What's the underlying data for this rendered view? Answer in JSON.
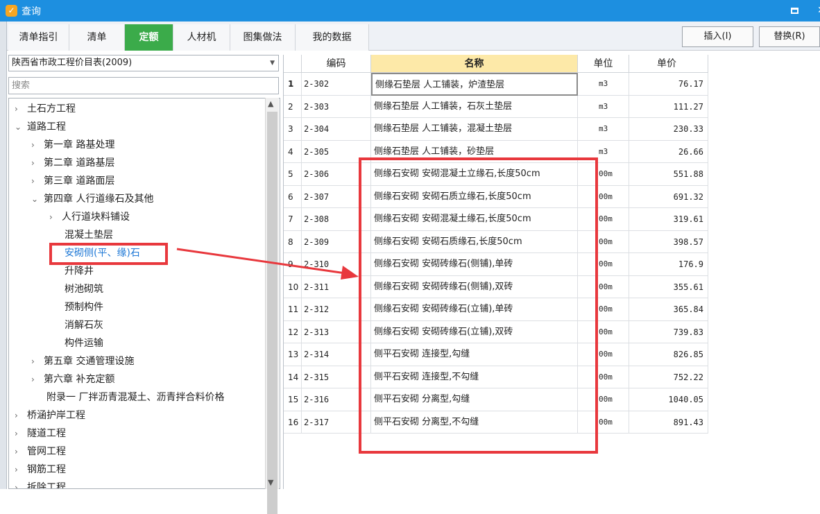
{
  "window": {
    "title": "查询",
    "app_icon_glyph": "✓"
  },
  "tabs": [
    {
      "label": "清单指引"
    },
    {
      "label": "清单"
    },
    {
      "label": "定额"
    },
    {
      "label": "人材机"
    },
    {
      "label": "图集做法"
    },
    {
      "label": "我的数据"
    }
  ],
  "actions": {
    "insert_label": "插入(I)",
    "replace_label": "替换(R)"
  },
  "left": {
    "combo_value": "陕西省市政工程价目表(2009)",
    "search_placeholder": "搜索",
    "tree": [
      {
        "label": "土石方工程",
        "chev": "›"
      },
      {
        "label": "道路工程",
        "chev": "⌄"
      },
      {
        "label": "第一章 路基处理",
        "chev": "›"
      },
      {
        "label": "第二章 道路基层",
        "chev": "›"
      },
      {
        "label": "第三章 道路面层",
        "chev": "›"
      },
      {
        "label": "第四章 人行道缘石及其他",
        "chev": "⌄"
      },
      {
        "label": "人行道块料铺设",
        "chev": "›"
      },
      {
        "label": "混凝土垫层",
        "chev": ""
      },
      {
        "label": "安砌侧(平、缘)石",
        "chev": ""
      },
      {
        "label": "升降井",
        "chev": ""
      },
      {
        "label": "树池砌筑",
        "chev": ""
      },
      {
        "label": "预制构件",
        "chev": ""
      },
      {
        "label": "消解石灰",
        "chev": ""
      },
      {
        "label": "构件运输",
        "chev": ""
      },
      {
        "label": "第五章 交通管理设施",
        "chev": "›"
      },
      {
        "label": "第六章 补充定额",
        "chev": "›"
      },
      {
        "label": "附录一 厂拌沥青混凝土、沥青拌合料价格",
        "chev": ""
      },
      {
        "label": "桥涵护岸工程",
        "chev": "›"
      },
      {
        "label": "隧道工程",
        "chev": "›"
      },
      {
        "label": "管网工程",
        "chev": "›"
      },
      {
        "label": "钢筋工程",
        "chev": "›"
      },
      {
        "label": "拆除工程",
        "chev": "›"
      }
    ]
  },
  "grid": {
    "headers": {
      "code": "编码",
      "name": "名称",
      "unit": "单位",
      "price": "单价"
    },
    "rows": [
      {
        "num": "1",
        "code": "2-302",
        "name": "侧缘石垫层 人工铺装，炉渣垫层",
        "unit": "m3",
        "price": "76.17"
      },
      {
        "num": "2",
        "code": "2-303",
        "name": "侧缘石垫层 人工铺装，石灰土垫层",
        "unit": "m3",
        "price": "111.27"
      },
      {
        "num": "3",
        "code": "2-304",
        "name": "侧缘石垫层 人工铺装，混凝土垫层",
        "unit": "m3",
        "price": "230.33"
      },
      {
        "num": "4",
        "code": "2-305",
        "name": "侧缘石垫层 人工铺装，砂垫层",
        "unit": "m3",
        "price": "26.66"
      },
      {
        "num": "5",
        "code": "2-306",
        "name": "侧缘石安砌 安砌混凝土立缘石,长度50cm",
        "unit": "00m",
        "price": "551.88"
      },
      {
        "num": "6",
        "code": "2-307",
        "name": "侧缘石安砌 安砌石质立缘石,长度50cm",
        "unit": "00m",
        "price": "691.32"
      },
      {
        "num": "7",
        "code": "2-308",
        "name": "侧缘石安砌 安砌混凝土缘石,长度50cm",
        "unit": "00m",
        "price": "319.61"
      },
      {
        "num": "8",
        "code": "2-309",
        "name": "侧缘石安砌 安砌石质缘石,长度50cm",
        "unit": "00m",
        "price": "398.57"
      },
      {
        "num": "9",
        "code": "2-310",
        "name": "侧缘石安砌 安砌砖缘石(侧铺),单砖",
        "unit": "00m",
        "price": "176.9"
      },
      {
        "num": "10",
        "code": "2-311",
        "name": "侧缘石安砌 安砌砖缘石(侧铺),双砖",
        "unit": "00m",
        "price": "355.61"
      },
      {
        "num": "11",
        "code": "2-312",
        "name": "侧缘石安砌 安砌砖缘石(立铺),单砖",
        "unit": "00m",
        "price": "365.84"
      },
      {
        "num": "12",
        "code": "2-313",
        "name": "侧缘石安砌 安砌砖缘石(立铺),双砖",
        "unit": "00m",
        "price": "739.83"
      },
      {
        "num": "13",
        "code": "2-314",
        "name": "侧平石安砌 连接型,勾缝",
        "unit": "00m",
        "price": "826.85"
      },
      {
        "num": "14",
        "code": "2-315",
        "name": "侧平石安砌 连接型,不勾缝",
        "unit": "00m",
        "price": "752.22"
      },
      {
        "num": "15",
        "code": "2-316",
        "name": "侧平石安砌 分离型,勾缝",
        "unit": "00m",
        "price": "1040.05"
      },
      {
        "num": "16",
        "code": "2-317",
        "name": "侧平石安砌 分离型,不勾缝",
        "unit": "00m",
        "price": "891.43"
      }
    ]
  },
  "colors": {
    "titlebar": "#1d8fe0",
    "active_tab": "#3bab4a",
    "annotation": "#e8383d",
    "name_header": "#fde9a8",
    "selected_tree": "#1e78d6"
  }
}
